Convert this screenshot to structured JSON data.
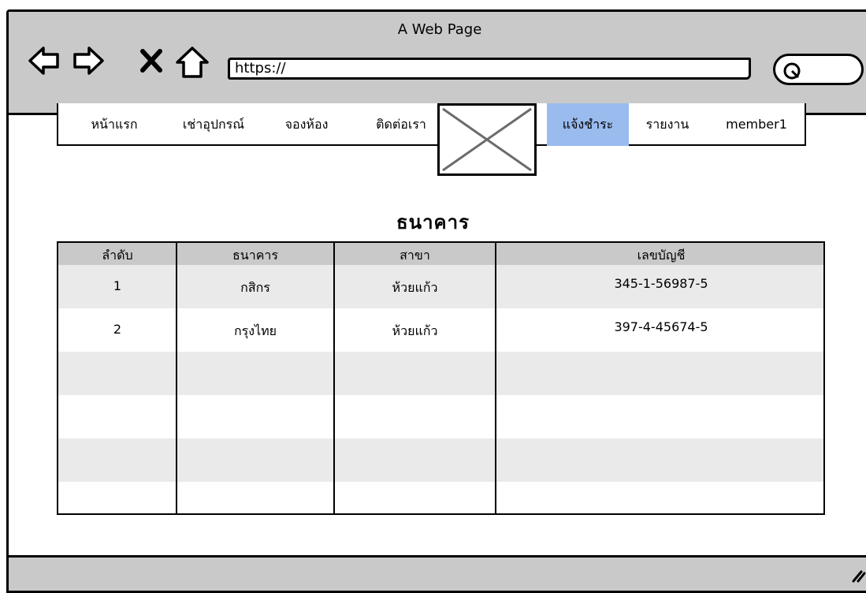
{
  "window": {
    "title": "A Web Page"
  },
  "toolbar": {
    "icons": [
      "back-arrow-icon",
      "forward-arrow-icon",
      "close-x-icon",
      "home-icon",
      "search-icon"
    ],
    "url": "https://"
  },
  "nav": {
    "items": [
      {
        "label": "หน้าแรก",
        "active": false
      },
      {
        "label": "เช่าอุปกรณ์",
        "active": false
      },
      {
        "label": "จองห้อง",
        "active": false
      },
      {
        "label": "ติดต่อเรา",
        "active": false
      },
      {
        "label": "แจ้งชำระ",
        "active": true
      },
      {
        "label": "รายงาน",
        "active": false
      },
      {
        "label": "member1",
        "active": false
      }
    ],
    "logo": "image-placeholder-icon",
    "active_color": "#99bbee"
  },
  "main": {
    "heading": "ธนาคาร",
    "table": {
      "columns": [
        "ลำดับ",
        "ธนาคาร",
        "สาขา",
        "เลขบัญชี"
      ],
      "rows": [
        [
          "1",
          "กสิกร",
          "ห้วยแก้ว",
          "345-1-56987-5"
        ],
        [
          "2",
          "กรุงไทย",
          "ห้วยแก้ว",
          "397-4-45674-5"
        ],
        [
          "",
          "",
          "",
          ""
        ],
        [
          "",
          "",
          "",
          ""
        ],
        [
          "",
          "",
          "",
          ""
        ],
        [
          "",
          "",
          "",
          ""
        ]
      ]
    }
  },
  "colors": {
    "chrome": "#c9c9c9",
    "row_shade": "#eaeaea"
  }
}
